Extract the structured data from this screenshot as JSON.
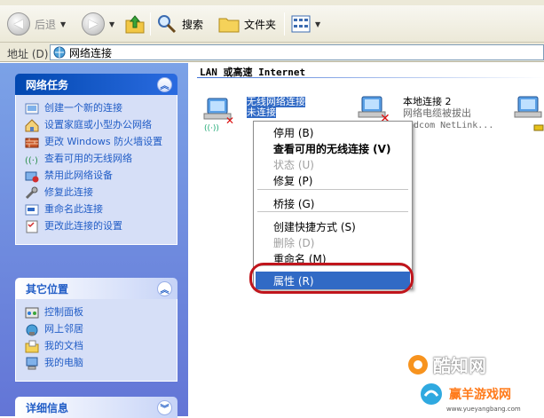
{
  "toolbar": {
    "back_label": "后退",
    "search_label": "搜索",
    "folders_label": "文件夹"
  },
  "address": {
    "label": "地址 (D)",
    "value": "网络连接"
  },
  "network_tasks": {
    "title": "网络任务",
    "items": [
      {
        "label": "创建一个新的连接",
        "icon": "new-connection-icon"
      },
      {
        "label": "设置家庭或小型办公网络",
        "icon": "home-network-icon"
      },
      {
        "label": "更改 Windows 防火墙设置",
        "icon": "firewall-icon"
      },
      {
        "label": "查看可用的无线网络",
        "icon": "wireless-icon"
      },
      {
        "label": "禁用此网络设备",
        "icon": "disable-device-icon"
      },
      {
        "label": "修复此连接",
        "icon": "repair-icon"
      },
      {
        "label": "重命名此连接",
        "icon": "rename-icon"
      },
      {
        "label": "更改此连接的设置",
        "icon": "settings-icon"
      }
    ]
  },
  "other_places": {
    "title": "其它位置",
    "items": [
      {
        "label": "控制面板",
        "icon": "control-panel-icon"
      },
      {
        "label": "网上邻居",
        "icon": "network-places-icon"
      },
      {
        "label": "我的文档",
        "icon": "documents-icon"
      },
      {
        "label": "我的电脑",
        "icon": "computer-icon"
      }
    ]
  },
  "details": {
    "title": "详细信息"
  },
  "content": {
    "group_title": "LAN 或高速 Internet",
    "wireless": {
      "name": "无线网络连接",
      "status": "未连接"
    },
    "local": {
      "name": "本地连接 2",
      "status": "网络电缆被拔出",
      "device": "oadcom NetLink..."
    }
  },
  "context_menu": [
    {
      "label": "停用 (B)",
      "style": "normal"
    },
    {
      "label": "查看可用的无线连接 (V)",
      "style": "bold"
    },
    {
      "label": "状态 (U)",
      "style": "disabled"
    },
    {
      "label": "修复 (P)",
      "style": "normal"
    },
    {
      "label": "桥接 (G)",
      "style": "normal"
    },
    {
      "label": "创建快捷方式 (S)",
      "style": "normal"
    },
    {
      "label": "删除 (D)",
      "style": "disabled"
    },
    {
      "label": "重命名 (M)",
      "style": "normal"
    },
    {
      "label": "属性 (R)",
      "style": "selected"
    }
  ],
  "watermarks": {
    "brand1": "酷知网",
    "brand2": "赢羊游戏网",
    "url": "www.yueyangbang.com"
  },
  "colors": {
    "selection": "#316ac5",
    "panel_header": "#0248b0",
    "link": "#215dc6",
    "highlight_oval": "#c0151c"
  }
}
